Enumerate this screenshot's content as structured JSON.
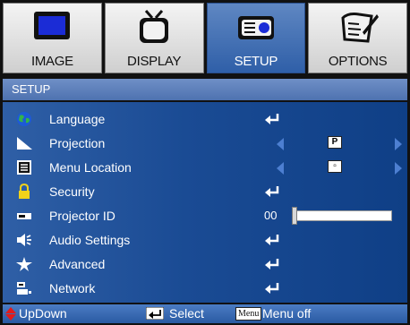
{
  "tabs": [
    {
      "label": "IMAGE",
      "icon": "monitor-icon",
      "active": false
    },
    {
      "label": "DISPLAY",
      "icon": "tv-icon",
      "active": false
    },
    {
      "label": "SETUP",
      "icon": "projector-icon",
      "active": true
    },
    {
      "label": "OPTIONS",
      "icon": "checklist-pen-icon",
      "active": false
    }
  ],
  "section": {
    "title": "SETUP"
  },
  "menu": [
    {
      "label": "Language",
      "icon": "globe-icon",
      "control": "enter"
    },
    {
      "label": "Projection",
      "icon": "projection-icon",
      "control": "select",
      "value": "P"
    },
    {
      "label": "Menu Location",
      "icon": "menu-location-icon",
      "control": "select",
      "value": "▫"
    },
    {
      "label": "Security",
      "icon": "lock-icon",
      "control": "enter"
    },
    {
      "label": "Projector ID",
      "icon": "projector-id-icon",
      "control": "slider",
      "value": "00",
      "fraction": 0.0
    },
    {
      "label": "Audio Settings",
      "icon": "speaker-icon",
      "control": "enter"
    },
    {
      "label": "Advanced",
      "icon": "star-icon",
      "control": "enter"
    },
    {
      "label": "Network",
      "icon": "network-icon",
      "control": "enter"
    }
  ],
  "footer": {
    "updown": "UpDown",
    "select": "Select",
    "menu_key": "Menu",
    "menu_off": "Menu off"
  },
  "colors": {
    "accent": "#2f5fa8",
    "arrow": "#4d7fd1",
    "header": "#5c7fbf"
  }
}
